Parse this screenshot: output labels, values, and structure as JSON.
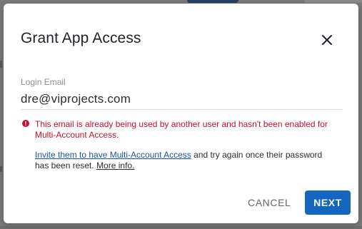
{
  "dialog": {
    "title": "Grant App Access",
    "close_icon": "close-icon"
  },
  "form": {
    "email_label": "Login Email",
    "email_value": "dre@viprojects.com"
  },
  "error": {
    "icon": "error-icon",
    "color": "#c8102e",
    "message": "This email is already being used by another user and hasn't been enabled for Multi-Account Access."
  },
  "info": {
    "invite_link": "Invite them to have Multi-Account Access",
    "middle_text": " and try again once their password has been reset. ",
    "more_info_link": "More info."
  },
  "actions": {
    "cancel_label": "CANCEL",
    "next_label": "NEXT",
    "primary_color": "#1467c1"
  }
}
